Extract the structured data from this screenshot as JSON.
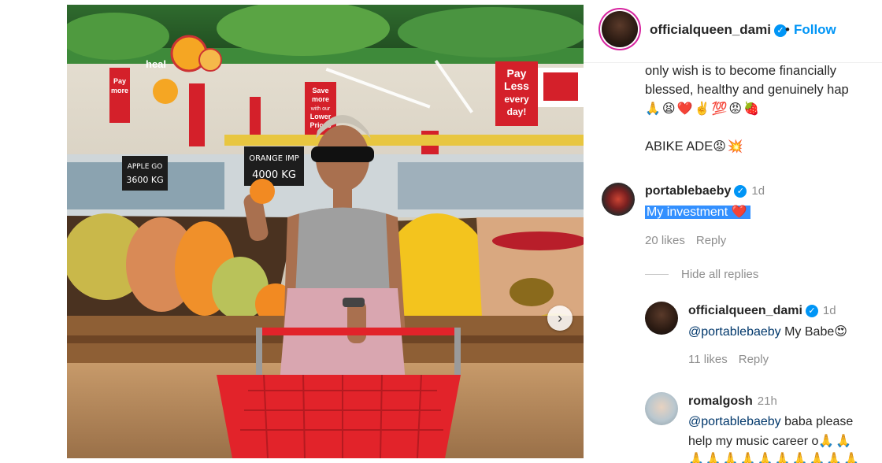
{
  "post": {
    "author": {
      "username": "officialqueen_dami",
      "verified_icon": "verified-badge-icon",
      "follow_label": "Follow",
      "separator": "•"
    },
    "caption": {
      "line1": "only wish is to become financially",
      "line2": "blessed, healthy and genuinely hap",
      "emojis": "🙏😫❤️✌️💯😡🍓",
      "signoff": "ABIKE ADE",
      "signoff_emojis": "😡💥"
    },
    "photo": {
      "signs": {
        "pay_less": [
          "Pay",
          "Less",
          "every",
          "day!"
        ],
        "save_more": [
          "Save",
          "more",
          "with our",
          "Lower",
          "Prices"
        ],
        "pay_left": [
          "Pay",
          "more"
        ],
        "apple_price": [
          "APPLE GO",
          "3600 KG"
        ],
        "orange_price": [
          "ORANGE IMP",
          "4000 KG"
        ],
        "store_banner": "heal"
      },
      "carousel_next_icon": "chevron-right-icon"
    },
    "comments": [
      {
        "username": "portablebaeby",
        "verified": true,
        "time": "1d",
        "text": "My investment",
        "text_emoji": "❤️",
        "likes": "20 likes",
        "reply_label": "Reply",
        "hide_replies_label": "Hide all replies",
        "replies": [
          {
            "username": "officialqueen_dami",
            "verified": true,
            "time": "1d",
            "mention": "@portablebaeby",
            "text": " My Babe",
            "text_emoji": "😍",
            "likes": "11 likes",
            "reply_label": "Reply"
          },
          {
            "username": "romalgosh",
            "verified": false,
            "time": "21h",
            "mention": "@portablebaeby",
            "text_line1": " baba please",
            "text_line2": "help my music career o",
            "text_emoji": "🙏🙏",
            "trailing_emojis": "🙏🙏🙏🙏🙏🙏🙏🙏🙏🙏"
          }
        ]
      }
    ]
  },
  "colors": {
    "accent_blue": "#0095f6",
    "selection_blue": "#3390ff",
    "muted_text": "#8e8e8e",
    "basket_red": "#e2232a",
    "sign_red": "#d4202a"
  }
}
